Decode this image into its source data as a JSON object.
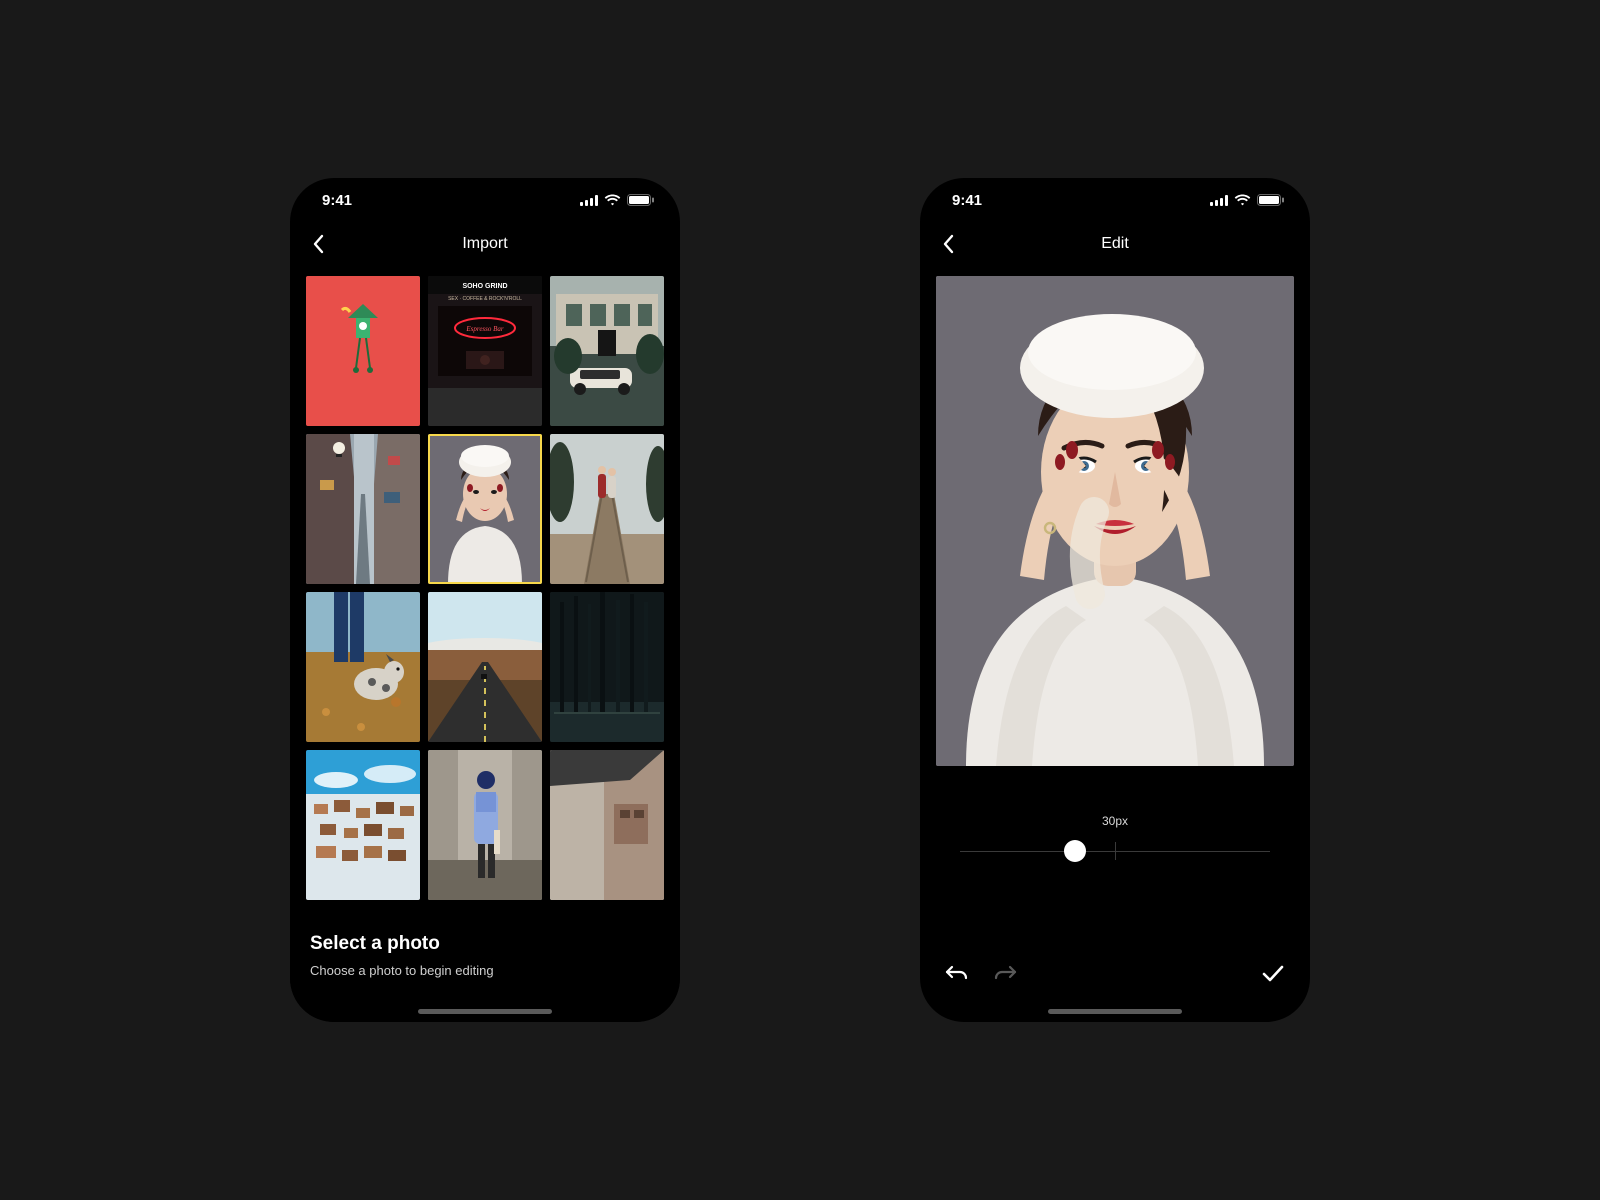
{
  "status": {
    "time": "9:41"
  },
  "import": {
    "nav_title": "Import",
    "prompt_title": "Select a photo",
    "prompt_sub": "Choose a photo to begin editing",
    "thumbs": [
      {
        "name": "cuckoo-clock-red",
        "selected": false
      },
      {
        "name": "soho-grind-cafe",
        "selected": false
      },
      {
        "name": "london-house-car",
        "selected": false
      },
      {
        "name": "melbourne-laneway",
        "selected": false
      },
      {
        "name": "woman-white-beret",
        "selected": true
      },
      {
        "name": "couple-on-pier",
        "selected": false
      },
      {
        "name": "dog-autumn-leaves",
        "selected": false
      },
      {
        "name": "desert-highway",
        "selected": false
      },
      {
        "name": "dark-forest",
        "selected": false
      },
      {
        "name": "snowy-town-aerial",
        "selected": false
      },
      {
        "name": "painter-overalls",
        "selected": false
      },
      {
        "name": "concrete-corner",
        "selected": false
      }
    ]
  },
  "edit": {
    "nav_title": "Edit",
    "brush_size_label": "30px",
    "brush_percent": 0.37,
    "icons": {
      "undo": "undo-icon",
      "redo": "redo-icon",
      "confirm": "check-icon"
    }
  }
}
